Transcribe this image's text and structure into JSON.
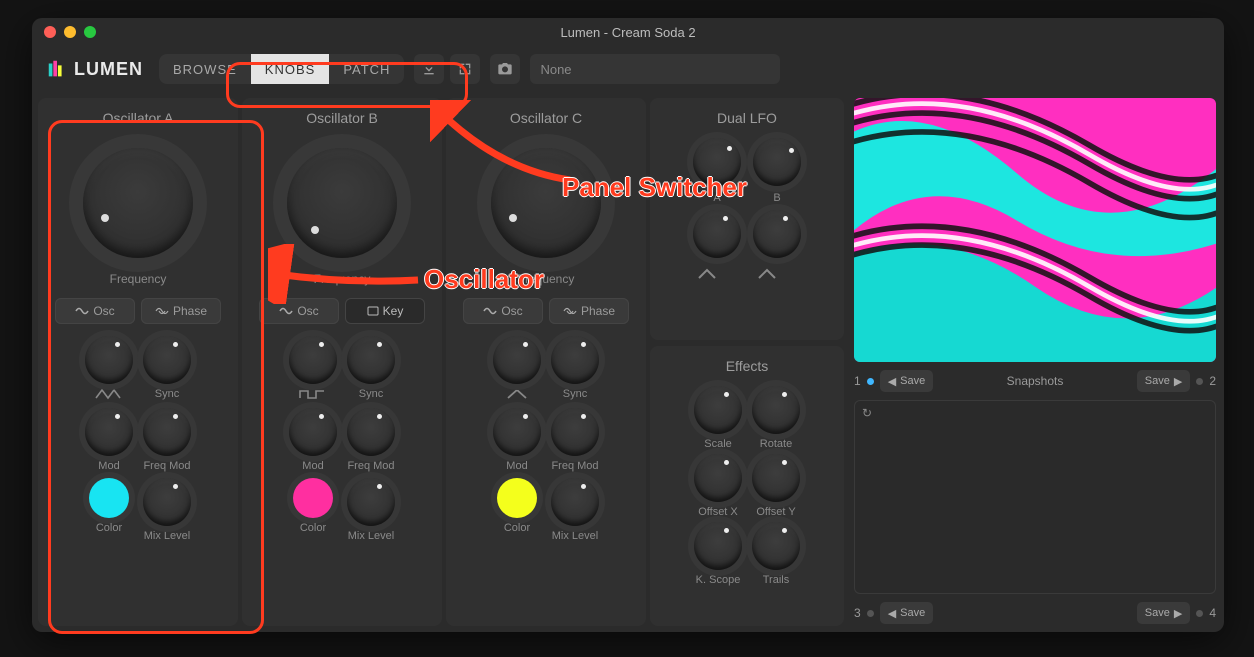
{
  "window": {
    "title": "Lumen - Cream Soda 2"
  },
  "logo": {
    "text": "LUMEN"
  },
  "tabs": {
    "browse": "BROWSE",
    "knobs": "KNOBS",
    "patch": "PATCH",
    "active": "knobs"
  },
  "preset": {
    "label": "None"
  },
  "oscA": {
    "title": "Oscillator A",
    "freq_label": "Frequency",
    "btn_osc": "Osc",
    "btn_phase": "Phase",
    "sync": "Sync",
    "mod": "Mod",
    "freqmod": "Freq Mod",
    "color": "Color",
    "mix": "Mix Level",
    "swatch": "#18e4f2"
  },
  "oscB": {
    "title": "Oscillator B",
    "freq_label": "Frequency",
    "btn_osc": "Osc",
    "btn_key": "Key",
    "sync": "Sync",
    "mod": "Mod",
    "freqmod": "Freq Mod",
    "color": "Color",
    "mix": "Mix Level",
    "swatch": "#ff2fa0"
  },
  "oscC": {
    "title": "Oscillator C",
    "freq_label": "Frequency",
    "btn_osc": "Osc",
    "btn_phase": "Phase",
    "sync": "Sync",
    "mod": "Mod",
    "freqmod": "Freq Mod",
    "color": "Color",
    "mix": "Mix Level",
    "swatch": "#f4ff1c"
  },
  "lfo": {
    "title": "Dual LFO",
    "a": "A",
    "b": "B"
  },
  "fx": {
    "title": "Effects",
    "scale": "Scale",
    "rotate": "Rotate",
    "ox": "Offset X",
    "oy": "Offset Y",
    "ks": "K. Scope",
    "tr": "Trails"
  },
  "snapshots": {
    "title": "Snapshots",
    "save": "Save",
    "n1": "1",
    "n2": "2",
    "n3": "3",
    "n4": "4"
  },
  "annotations": {
    "panel_switcher": "Panel Switcher",
    "oscillator": "Oscillator"
  }
}
